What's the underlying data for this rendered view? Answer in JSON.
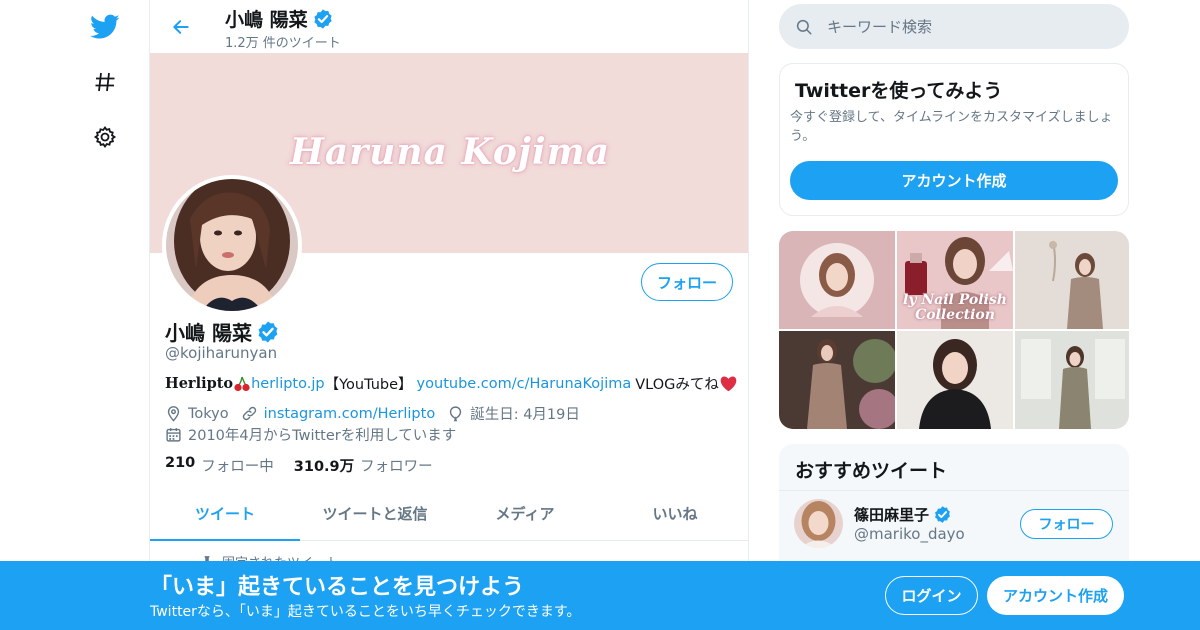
{
  "profile": {
    "name": "小嶋 陽菜",
    "tweet_count": "1.2万 件のツイート",
    "banner_text": "Haruna Kojima",
    "handle": "@kojiharunyan",
    "follow_label": "フォロー",
    "bio": {
      "brand": "Herlipto",
      "link1": "herlipto.jp",
      "youtube_label": " 【YouTube】",
      "link2": "youtube.com/c/HarunaKojima",
      "tail": " VLOGみてね"
    },
    "location": "Tokyo",
    "website": "instagram.com/Herlipto",
    "birthday": "誕生日: 4月19日",
    "joined": "2010年4月からTwitterを利用しています",
    "following_count": "210",
    "following_label": "フォロー中",
    "followers_count": "310.9万",
    "followers_label": "フォロワー"
  },
  "tabs": [
    "ツイート",
    "ツイートと返信",
    "メディア",
    "いいね"
  ],
  "pinned_label": "固定されたツイート",
  "search": {
    "placeholder": "キーワード検索"
  },
  "try_twitter": {
    "title": "Twitterを使ってみよう",
    "description": "今すぐ登録して、タイムラインをカスタマイズしましょう。",
    "button": "アカウント作成"
  },
  "media_overlay_text": [
    "ly Nail Polish",
    "Collection"
  ],
  "recommended": {
    "title": "おすすめツイート",
    "user_name": "篠田麻里子",
    "user_handle": "@mariko_dayo",
    "follow_label": "フォロー"
  },
  "bottom_banner": {
    "title": "「いま」起きていることを見つけよう",
    "subtitle": "Twitterなら、「いま」起きていることをいち早くチェックできます。",
    "login": "ログイン",
    "signup": "アカウント作成"
  },
  "colors": {
    "accent": "#1da1f2",
    "banner_bg": "#f1dcda",
    "secondary_text": "#657786",
    "border": "#e6ecf0"
  }
}
